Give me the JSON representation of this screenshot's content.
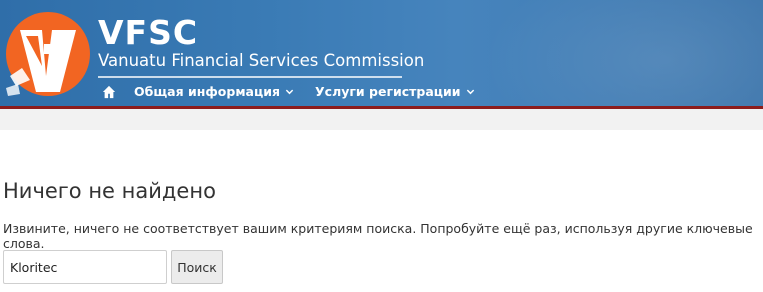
{
  "header": {
    "brand": "VFSC",
    "subtitle": "Vanuatu Financial Services Commission",
    "nav": [
      {
        "label": "Общая информация",
        "icon": "chevron-down-icon"
      },
      {
        "label": "Услуги регистрации",
        "icon": "chevron-down-icon"
      }
    ],
    "home_icon": "home-icon"
  },
  "main": {
    "title": "Ничего не найдено",
    "message": "Извините, ничего не соответствует вашим критериям поиска. Попробуйте ещё раз, используя другие ключевые слова.",
    "search": {
      "value": "Kloritec",
      "button_label": "Поиск"
    }
  },
  "colors": {
    "header_blue": "#3a7bb5",
    "accent_orange": "#f26522",
    "border_red": "#8c1c1c"
  }
}
